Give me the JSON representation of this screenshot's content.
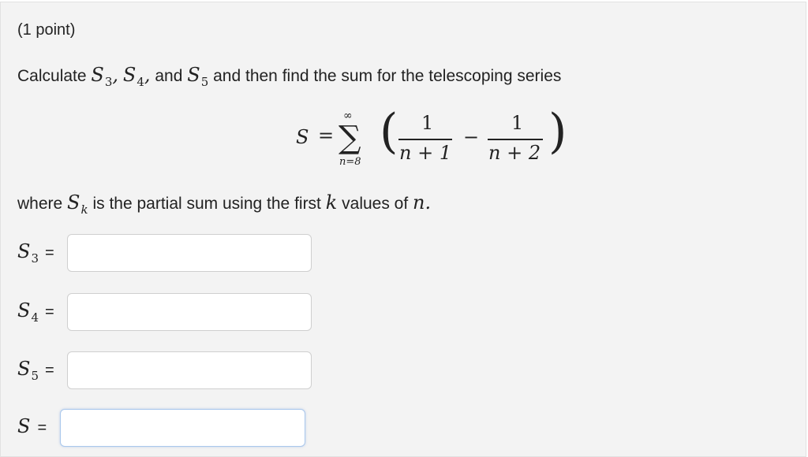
{
  "question": {
    "points": "(1 point)",
    "intro_pre": "Calculate",
    "intro_mid": "and then find the sum for the telescoping series",
    "where_pre": "where",
    "where_mid": "is the partial sum using the first",
    "where_post": "values of",
    "formula": {
      "lhs": "S",
      "equals": "=",
      "sum_symbol": "∑",
      "upper": "∞",
      "lower": "n=8",
      "num1": "1",
      "den1": "n + 1",
      "minus": "−",
      "num2": "1",
      "den2": "n + 2"
    }
  },
  "answers": [
    {
      "symbol": "S",
      "subscript": "3",
      "equals": "=",
      "value": ""
    },
    {
      "symbol": "S",
      "subscript": "4",
      "equals": "=",
      "value": ""
    },
    {
      "symbol": "S",
      "subscript": "5",
      "equals": "=",
      "value": ""
    },
    {
      "symbol": "S",
      "subscript": "",
      "equals": "=",
      "value": ""
    }
  ]
}
